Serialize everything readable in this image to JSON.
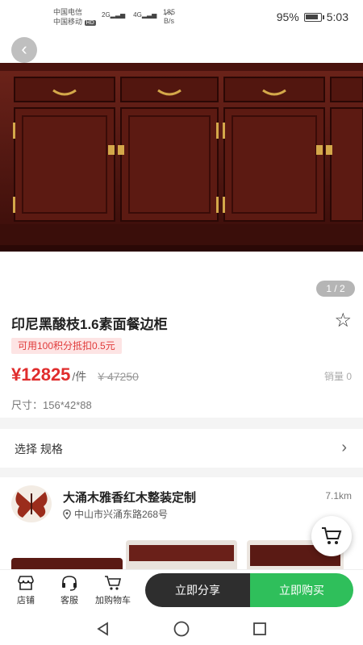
{
  "status_bar": {
    "carrier1": "中国电信",
    "carrier2": "中国移动",
    "hd": "HD",
    "net1": "2G",
    "net2": "4G",
    "speed_value": "185",
    "speed_unit": "B/s",
    "battery": "95%",
    "time": "5:03"
  },
  "gallery": {
    "pager": "1 / 2"
  },
  "product": {
    "title": "印尼黑酸枝1.6素面餐边柜",
    "points_tag": "可用100积分抵扣0.5元",
    "price": "¥12825",
    "unit": "/件",
    "original_price": "¥ 47250",
    "sales": "销量 0",
    "size": "尺寸：156*42*88"
  },
  "spec": {
    "label": "选择 规格"
  },
  "store": {
    "name": "大涌木雅香红木整装定制",
    "distance": "7.1km",
    "address": "中山市兴涌东路268号"
  },
  "bottom": {
    "store_label": "店铺",
    "service_label": "客服",
    "cart_label": "加购物车",
    "share_label": "立即分享",
    "buy_label": "立即购买"
  },
  "colors": {
    "price_red": "#e02d2d",
    "buy_green": "#2fbf5b",
    "share_dark": "#2e2e2e",
    "wood": "#5a1a14"
  }
}
